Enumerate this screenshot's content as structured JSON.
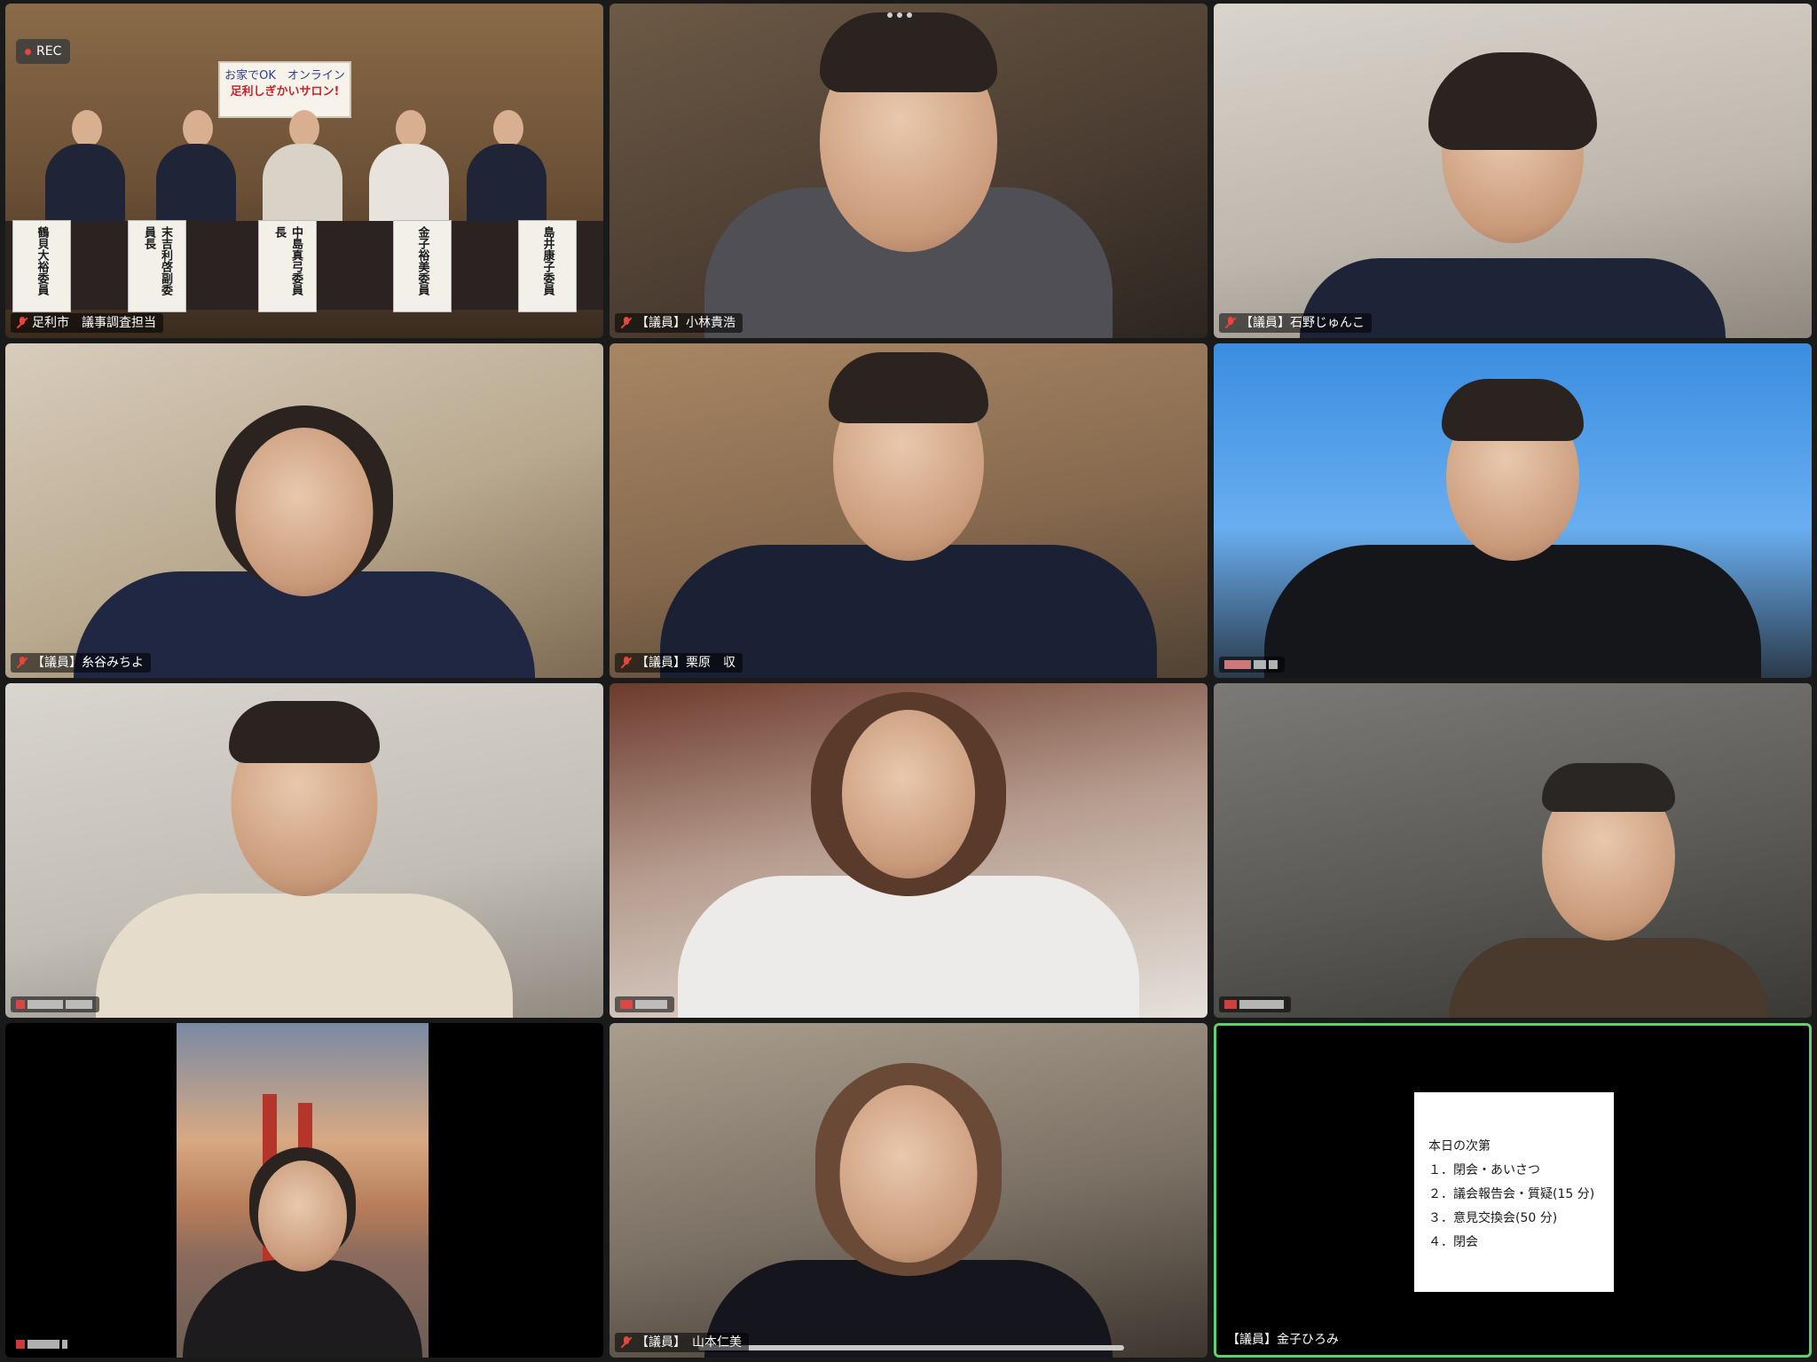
{
  "tiles": [
    {
      "id": "t1",
      "label": "足利市　議事調査担当",
      "rec": "REC",
      "banner": {
        "line1": "お家でOK　オンライン",
        "line2": "足利しぎかいサロン!"
      },
      "nameplates": [
        "鶴貝大裕委員",
        "末吉利啓副委員長",
        "中島真弓委員長",
        "金子裕美委員",
        "島井康子委員"
      ]
    },
    {
      "id": "t2",
      "label": "【議員】小林貴浩"
    },
    {
      "id": "t3",
      "label": "【議員】石野じゅんこ"
    },
    {
      "id": "t4",
      "label": "【議員】糸谷みちよ"
    },
    {
      "id": "t5",
      "label": "【議員】栗原　収"
    },
    {
      "id": "t6",
      "label": ""
    },
    {
      "id": "t7",
      "label": ""
    },
    {
      "id": "t8",
      "label": ""
    },
    {
      "id": "t9",
      "label": ""
    },
    {
      "id": "t10",
      "label": ""
    },
    {
      "id": "t11",
      "label": "【議員】　山本仁美"
    },
    {
      "id": "t12",
      "label": "【議員】金子ひろみ",
      "agenda": {
        "title": "本日の次第",
        "items": [
          "１．閉会・あいさつ",
          "２．議会報告会・質疑(15 分)",
          "３．意見交換会(50 分)",
          "４．閉会"
        ]
      }
    }
  ],
  "colors": {
    "active_border": "#5fd36a",
    "muted_mic": "#e8453c"
  }
}
